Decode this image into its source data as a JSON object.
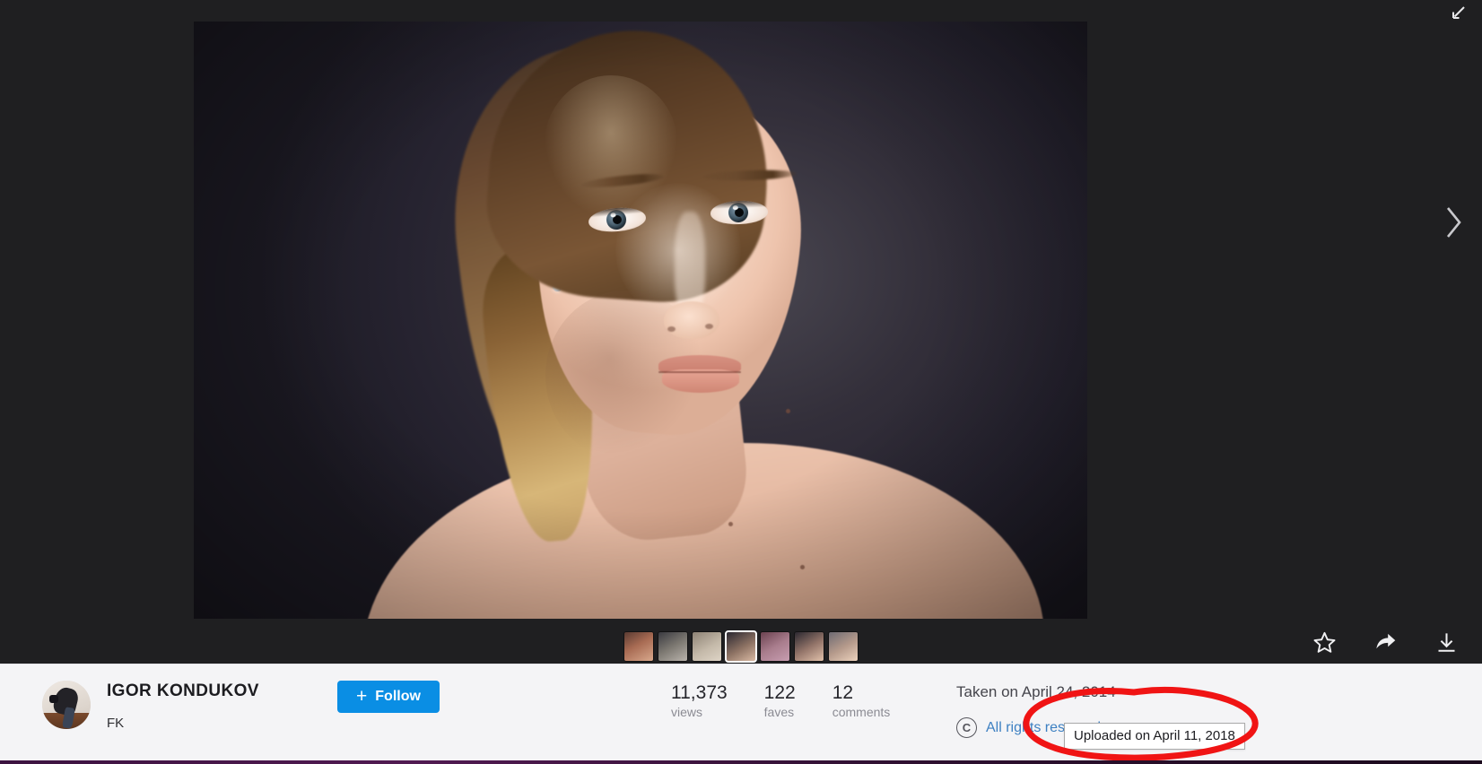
{
  "window": {
    "background_color": "#1f1f21",
    "infobar_color": "#f4f4f6"
  },
  "lightbox": {
    "exit_fullscreen_icon": "arrow-down-left-icon",
    "next_icon": "chevron-right-icon",
    "photo": {
      "alt": "Studio portrait of a young woman with long light-brown hair against a dark grey backdrop",
      "background_color": "#26252c"
    },
    "thumbnails": [
      {
        "name": "thumbnail-1",
        "active": false,
        "color_a": "#5a3b32",
        "color_b": "#d8a88c"
      },
      {
        "name": "thumbnail-2",
        "active": false,
        "color_a": "#3a3a40",
        "color_b": "#b9b3ac"
      },
      {
        "name": "thumbnail-3",
        "active": false,
        "color_a": "#8d8275",
        "color_b": "#ded4c6"
      },
      {
        "name": "thumbnail-4",
        "active": true,
        "color_a": "#2a2730",
        "color_b": "#d9b9a3"
      },
      {
        "name": "thumbnail-5",
        "active": false,
        "color_a": "#6b4250",
        "color_b": "#c79db0"
      },
      {
        "name": "thumbnail-6",
        "active": false,
        "color_a": "#2b2830",
        "color_b": "#e0c0aa"
      },
      {
        "name": "thumbnail-7",
        "active": false,
        "color_a": "#6d6a72",
        "color_b": "#ecd2bd"
      }
    ],
    "actions": [
      {
        "name": "favorite-button",
        "icon": "star-icon",
        "label": "Favorite"
      },
      {
        "name": "share-button",
        "icon": "share-arrow-icon",
        "label": "Share"
      },
      {
        "name": "download-button",
        "icon": "download-icon",
        "label": "Download"
      }
    ]
  },
  "infobar": {
    "owner": {
      "avatar_alt": "Photographer crouching with a camera",
      "name": "IGOR KONDUKOV",
      "subtitle": "FK"
    },
    "follow": {
      "plus": "+",
      "label": "Follow",
      "color": "#0a8ee4"
    },
    "stats": [
      {
        "name": "views-stat",
        "value": "11,373",
        "label": "views"
      },
      {
        "name": "faves-stat",
        "value": "122",
        "label": "faves"
      },
      {
        "name": "comments-stat",
        "value": "12",
        "label": "comments"
      }
    ],
    "dates": {
      "taken": "Taken on April 24, 2014",
      "uploaded_tooltip": "Uploaded on April 11, 2018"
    },
    "license": {
      "icon": "copyright-icon",
      "icon_glyph": "C",
      "label": "All rights reserved",
      "link_color": "#3d80c2"
    }
  },
  "annotation": {
    "type": "red-ellipse-highlight",
    "color": "#f01414",
    "target": "uploaded-on-tooltip"
  }
}
